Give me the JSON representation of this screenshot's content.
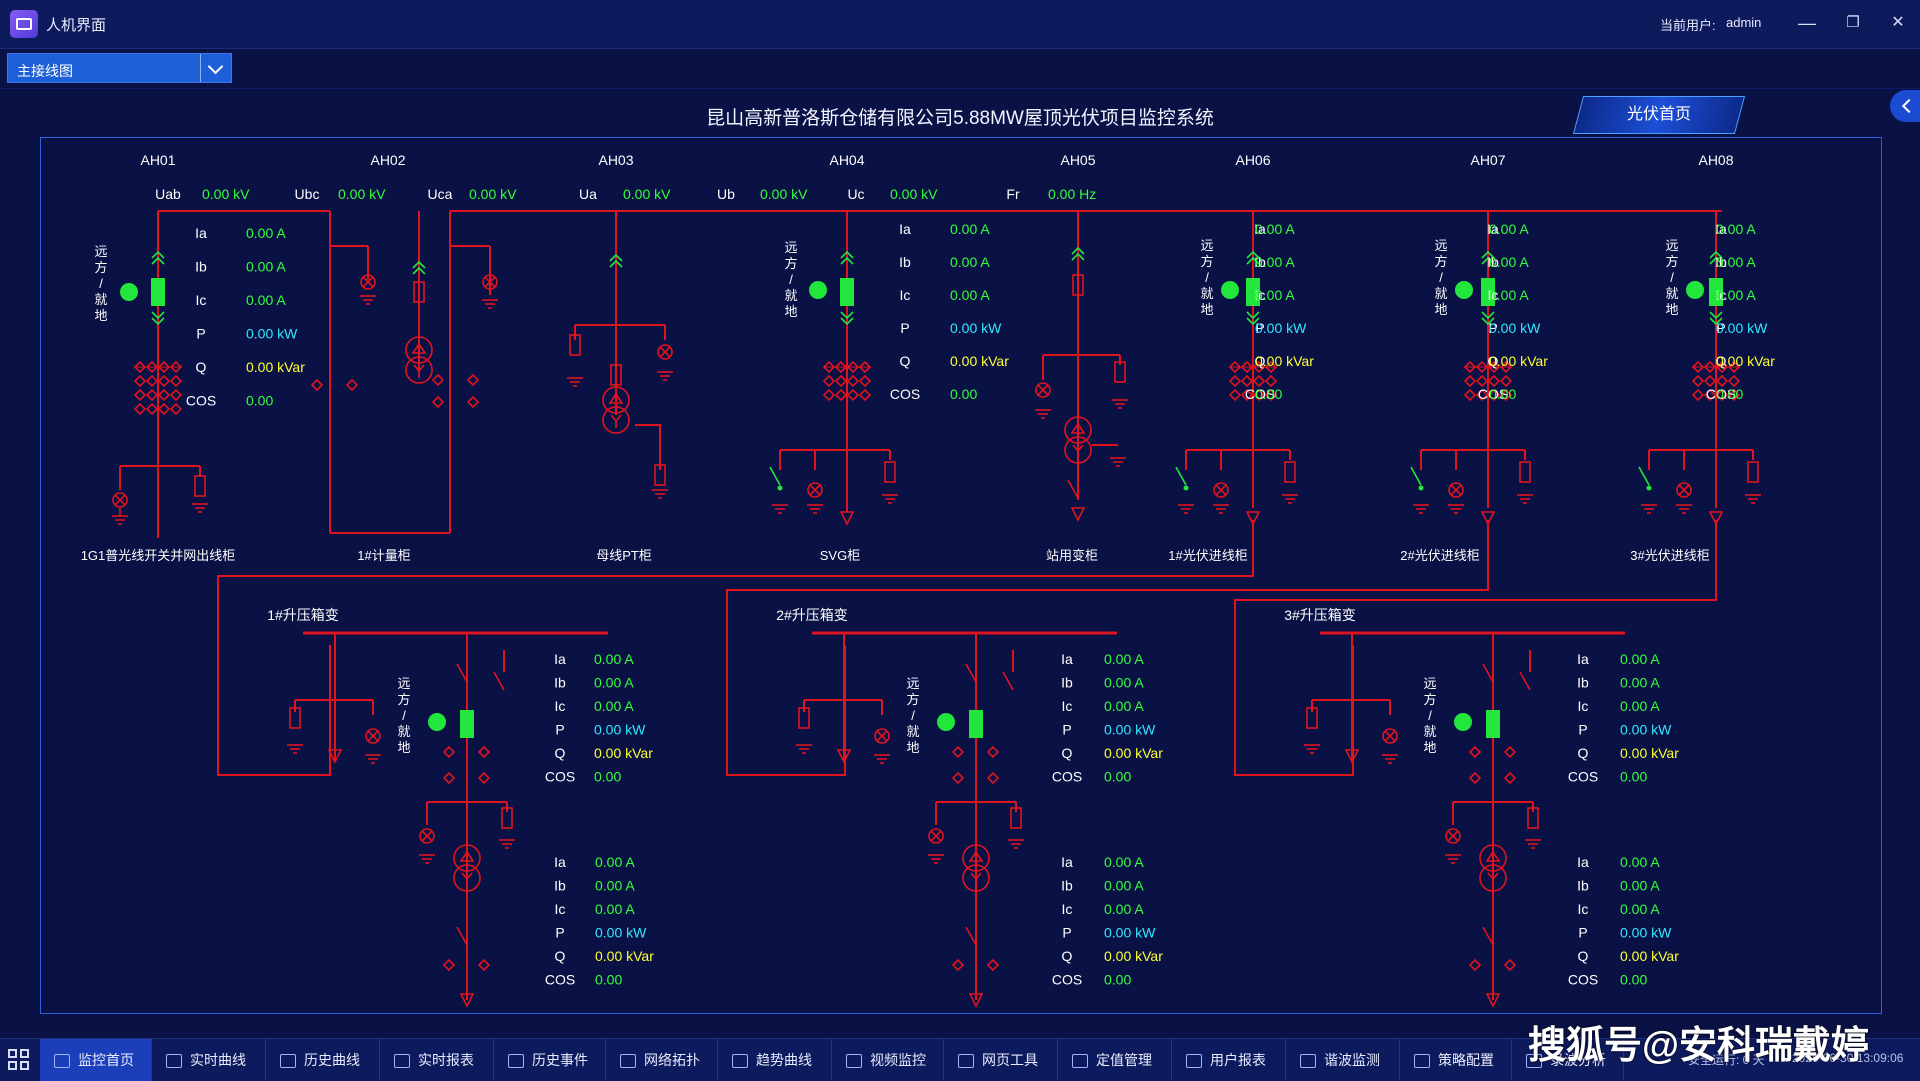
{
  "window": {
    "title": "人机界面",
    "user_label": "当前用户:",
    "user_name": "admin",
    "minimize": "—",
    "maximize": "❐",
    "close": "✕"
  },
  "view_select": {
    "value": "主接线图"
  },
  "main": {
    "title": "昆山高新普洛斯仓储有限公司5.88MW屋顶光伏项目监控系统",
    "pv_home_button": "光伏首页"
  },
  "colors": {
    "line": "#e0141e",
    "value_green": "#34ff3a",
    "value_cyan": "#33e7ff",
    "value_yellow": "#ffff33",
    "breaker_green": "#22e63c"
  },
  "bus_measurements": [
    {
      "label": "Uab",
      "value": "0.00 kV"
    },
    {
      "label": "Ubc",
      "value": "0.00 kV"
    },
    {
      "label": "Uca",
      "value": "0.00 kV"
    },
    {
      "label": "Ua",
      "value": "0.00 kV"
    },
    {
      "label": "Ub",
      "value": "0.00 kV"
    },
    {
      "label": "Uc",
      "value": "0.00 kV"
    },
    {
      "label": "Fr",
      "value": "0.00 Hz"
    }
  ],
  "remote_local_label": [
    "远",
    "方",
    "/",
    "就",
    "地"
  ],
  "cabinets": [
    {
      "code": "AH01",
      "name": "1G1普光线开关并网出线柜"
    },
    {
      "code": "AH02",
      "name": "1#计量柜"
    },
    {
      "code": "AH03",
      "name": "母线PT柜"
    },
    {
      "code": "AH04",
      "name": "SVG柜"
    },
    {
      "code": "AH05",
      "name": "站用变柜"
    },
    {
      "code": "AH06",
      "name": "1#光伏进线柜"
    },
    {
      "code": "AH07",
      "name": "2#光伏进线柜"
    },
    {
      "code": "AH08",
      "name": "3#光伏进线柜"
    }
  ],
  "measure_set": [
    {
      "label": "Ia",
      "value": "0.00 A",
      "tone": "green"
    },
    {
      "label": "Ib",
      "value": "0.00 A",
      "tone": "green"
    },
    {
      "label": "Ic",
      "value": "0.00 A",
      "tone": "green"
    },
    {
      "label": "P",
      "value": "0.00 kW",
      "tone": "cyan"
    },
    {
      "label": "Q",
      "value": "0.00 kVar",
      "tone": "yellow"
    },
    {
      "label": "COS",
      "value": "0.00",
      "tone": "green"
    }
  ],
  "transformers": [
    {
      "name": "1#升压箱变"
    },
    {
      "name": "2#升压箱变"
    },
    {
      "name": "3#升压箱变"
    }
  ],
  "taskbar": {
    "items": [
      "监控首页",
      "实时曲线",
      "历史曲线",
      "实时报表",
      "历史事件",
      "网络拓扑",
      "趋势曲线",
      "视频监控",
      "网页工具",
      "定值管理",
      "用户报表",
      "谐波监测",
      "策略配置",
      "录波分析"
    ],
    "active_index": 0,
    "status_text": "安全运行: 0 天",
    "datetime": "2025-06-30 13:09:06"
  },
  "watermark": "搜狐号@安科瑞戴婷"
}
